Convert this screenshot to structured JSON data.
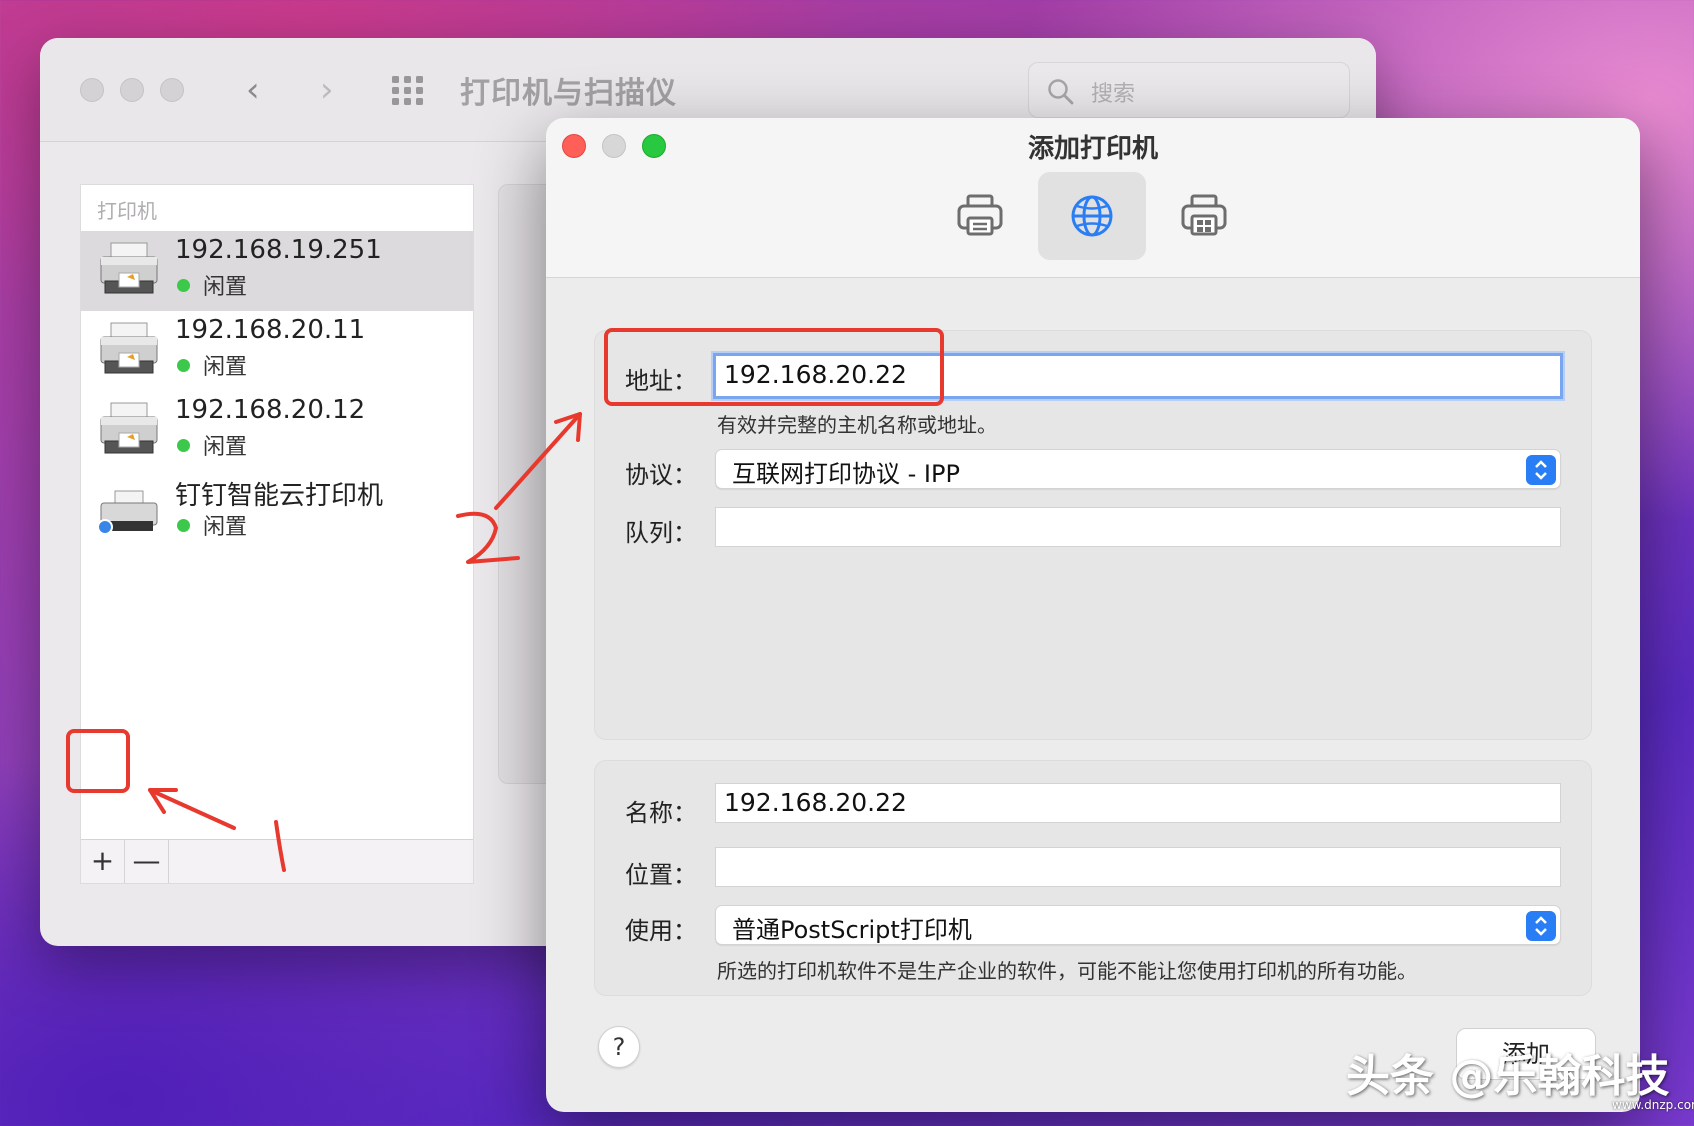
{
  "back_window": {
    "title": "打印机与扫描仪",
    "search_placeholder": "搜索",
    "list_header": "打印机",
    "printers": [
      {
        "name": "192.168.19.251",
        "status": "闲置"
      },
      {
        "name": "192.168.20.11",
        "status": "闲置"
      },
      {
        "name": "192.168.20.12",
        "status": "闲置"
      },
      {
        "name": "钉钉智能云打印机",
        "status": "闲置"
      }
    ],
    "add_label": "+",
    "remove_label": "—"
  },
  "dialog": {
    "title": "添加打印机",
    "address_label": "地址：",
    "address_value": "192.168.20.22",
    "address_hint": "有效并完整的主机名称或地址。",
    "protocol_label": "协议：",
    "protocol_value": "互联网打印协议 - IPP",
    "queue_label": "队列：",
    "queue_value": "",
    "name_label": "名称：",
    "name_value": "192.168.20.22",
    "location_label": "位置：",
    "location_value": "",
    "use_label": "使用：",
    "use_value": "普通PostScript打印机",
    "use_hint": "所选的打印机软件不是生产企业的软件，可能不能让您使用打印机的所有功能。",
    "help_label": "?",
    "add_button": "添加"
  },
  "annotations": {
    "step1": "1",
    "step2": "2"
  },
  "watermark": {
    "main": "头条 @乐翰科技",
    "small": "www.dnzp.com"
  },
  "colors": {
    "accent": "#2a7ef5",
    "status_idle": "#3cc84a",
    "annotation_red": "#e8392f",
    "close": "#fe5f57",
    "zoom": "#28c840"
  }
}
